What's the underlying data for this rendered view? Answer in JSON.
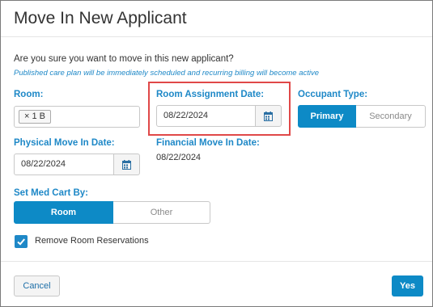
{
  "dialog": {
    "title": "Move In New Applicant",
    "question": "Are you sure you want to move in this new applicant?",
    "note": "Published care plan will be immediately scheduled and recurring billing will become active"
  },
  "room": {
    "label": "Room:",
    "tag": "× 1 B"
  },
  "room_assignment": {
    "label": "Room Assignment Date:",
    "value": "08/22/2024"
  },
  "occupant_type": {
    "label": "Occupant Type:",
    "options": [
      "Primary",
      "Secondary"
    ],
    "selected": "Primary"
  },
  "physical_move_in": {
    "label": "Physical Move In Date:",
    "value": "08/22/2024"
  },
  "financial_move_in": {
    "label": "Financial Move In Date:",
    "value": "08/22/2024"
  },
  "med_cart": {
    "label": "Set Med Cart By:",
    "options": [
      "Room",
      "Other"
    ],
    "selected": "Room"
  },
  "remove_reservations": {
    "label": "Remove Room Reservations",
    "checked": true
  },
  "footer": {
    "cancel_label": "Cancel",
    "yes_label": "Yes"
  },
  "icons": {
    "calendar": "calendar-icon",
    "check": "checkmark-icon"
  },
  "colors": {
    "accent": "#0d8ac6",
    "label": "#1e88c7",
    "highlight": "#e04848"
  }
}
